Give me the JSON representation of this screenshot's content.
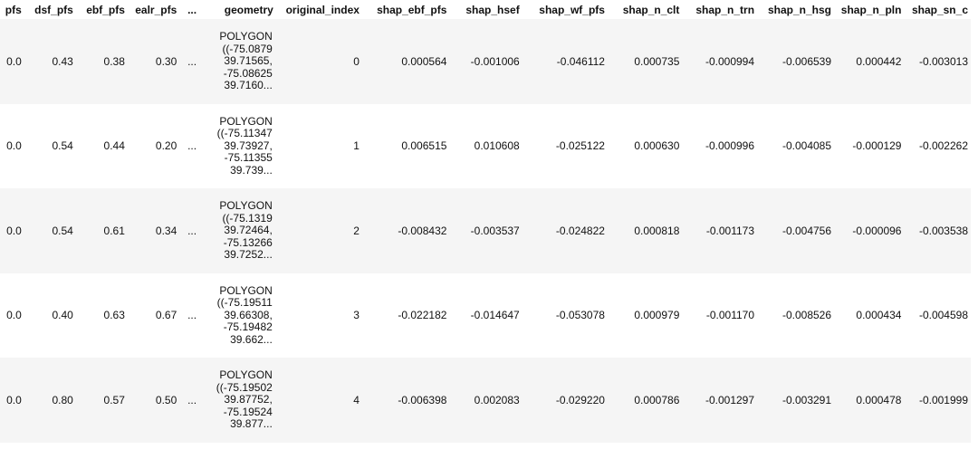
{
  "table": {
    "headers": [
      "pfs",
      "dsf_pfs",
      "ebf_pfs",
      "ealr_pfs",
      "...",
      "geometry",
      "original_index",
      "shap_ebf_pfs",
      "shap_hsef",
      "shap_wf_pfs",
      "shap_n_clt",
      "shap_n_trn",
      "shap_n_hsg",
      "shap_n_pln",
      "shap_sn_c"
    ],
    "rows": [
      [
        "0.0",
        "0.43",
        "0.38",
        "0.30",
        "...",
        "POLYGON\n((-75.0879\n39.71565,\n-75.08625\n39.7160...",
        "0",
        "0.000564",
        "-0.001006",
        "-0.046112",
        "0.000735",
        "-0.000994",
        "-0.006539",
        "0.000442",
        "-0.003013"
      ],
      [
        "0.0",
        "0.54",
        "0.44",
        "0.20",
        "...",
        "POLYGON\n((-75.11347\n39.73927,\n-75.11355\n39.739...",
        "1",
        "0.006515",
        "0.010608",
        "-0.025122",
        "0.000630",
        "-0.000996",
        "-0.004085",
        "-0.000129",
        "-0.002262"
      ],
      [
        "0.0",
        "0.54",
        "0.61",
        "0.34",
        "...",
        "POLYGON\n((-75.1319\n39.72464,\n-75.13266\n39.7252...",
        "2",
        "-0.008432",
        "-0.003537",
        "-0.024822",
        "0.000818",
        "-0.001173",
        "-0.004756",
        "-0.000096",
        "-0.003538"
      ],
      [
        "0.0",
        "0.40",
        "0.63",
        "0.67",
        "...",
        "POLYGON\n((-75.19511\n39.66308,\n-75.19482\n39.662...",
        "3",
        "-0.022182",
        "-0.014647",
        "-0.053078",
        "0.000979",
        "-0.001170",
        "-0.008526",
        "0.000434",
        "-0.004598"
      ],
      [
        "0.0",
        "0.80",
        "0.57",
        "0.50",
        "...",
        "POLYGON\n((-75.19502\n39.87752,\n-75.19524\n39.877...",
        "4",
        "-0.006398",
        "0.002083",
        "-0.029220",
        "0.000786",
        "-0.001297",
        "-0.003291",
        "0.000478",
        "-0.001999"
      ]
    ]
  }
}
